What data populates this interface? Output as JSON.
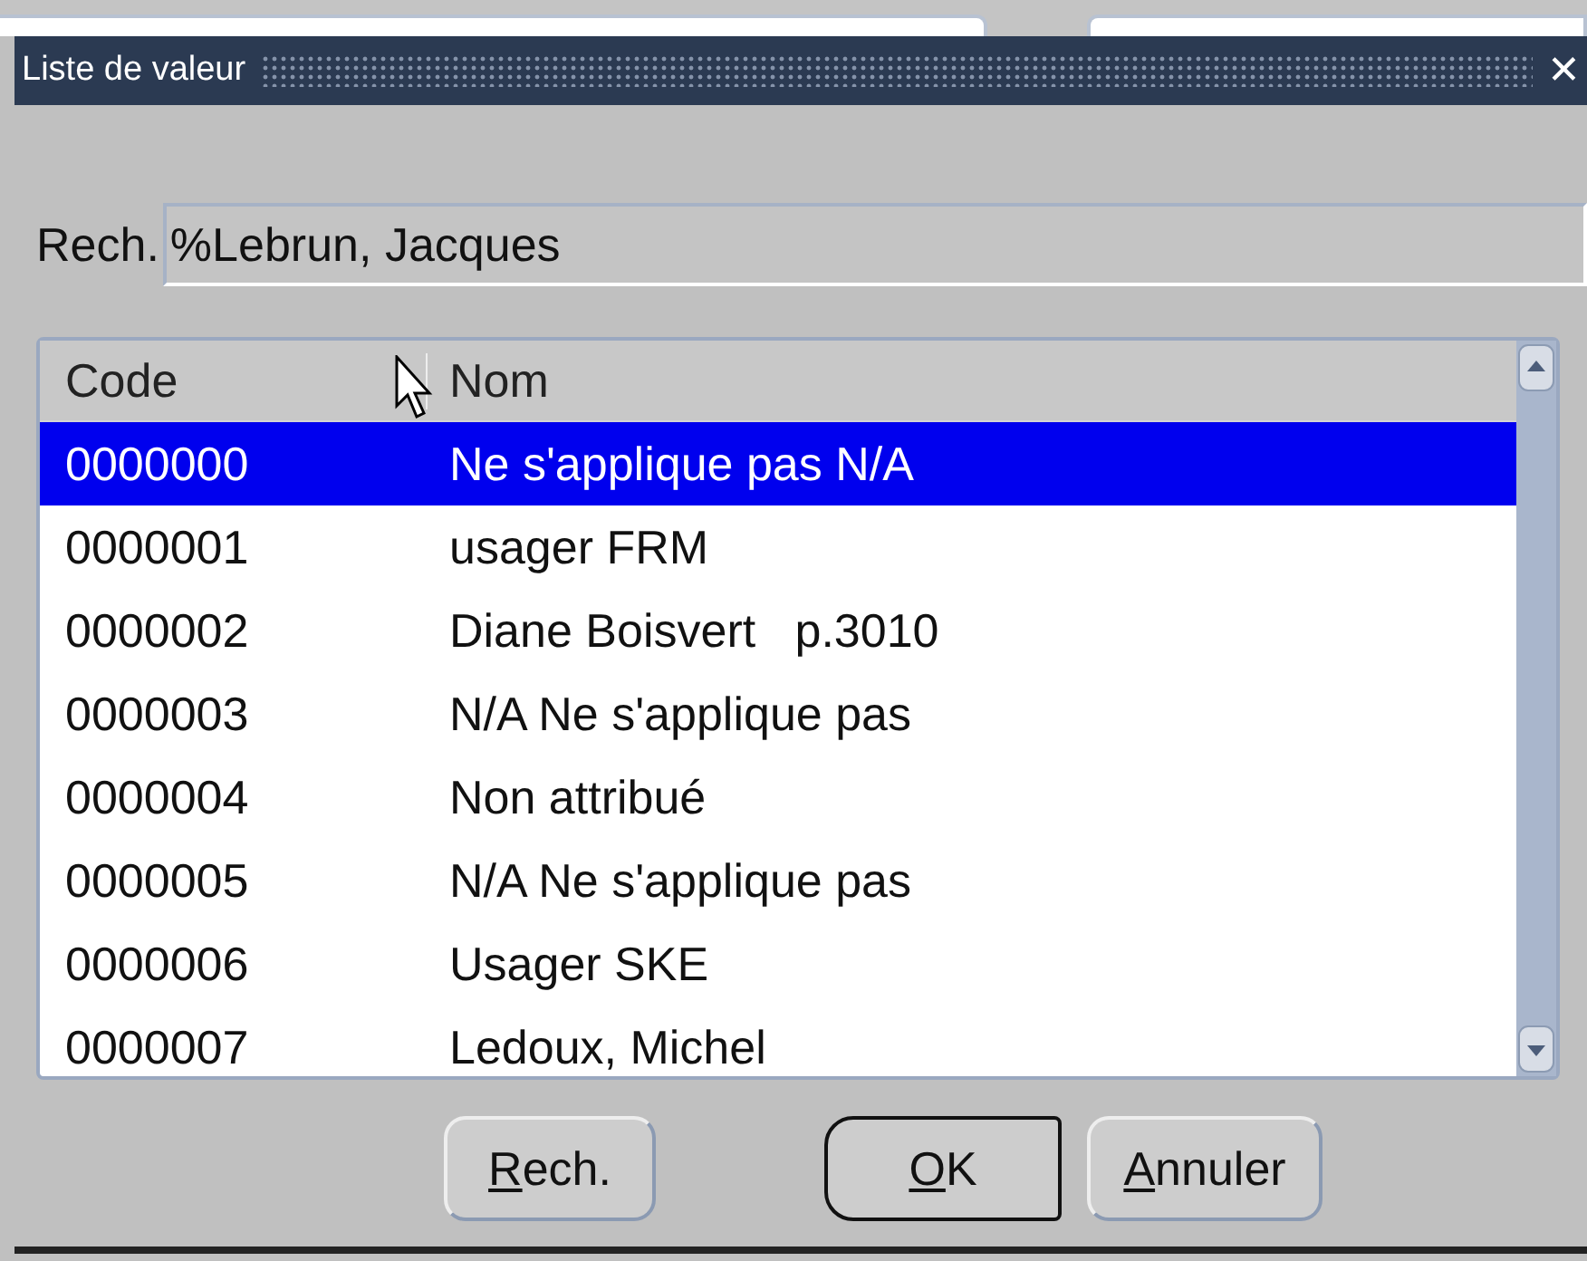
{
  "window": {
    "title": "Liste de valeur",
    "close": "✕"
  },
  "search": {
    "label": "Rech.",
    "value": "%Lebrun, Jacques"
  },
  "table": {
    "columns": [
      "Code",
      "Nom"
    ],
    "rows": [
      {
        "code": "0000000",
        "name": "Ne s'applique pas N/A",
        "selected": true
      },
      {
        "code": "0000001",
        "name": "usager FRM",
        "selected": false
      },
      {
        "code": "0000002",
        "name": "Diane Boisvert   p.3010",
        "selected": false
      },
      {
        "code": "0000003",
        "name": "N/A Ne s'applique pas",
        "selected": false
      },
      {
        "code": "0000004",
        "name": "Non attribué",
        "selected": false
      },
      {
        "code": "0000005",
        "name": "N/A Ne s'applique pas",
        "selected": false
      },
      {
        "code": "0000006",
        "name": "Usager SKE",
        "selected": false
      },
      {
        "code": "0000007",
        "name": "Ledoux, Michel",
        "selected": false
      }
    ]
  },
  "buttons": [
    {
      "label": "Rech.",
      "default": false
    },
    {
      "label": "OK",
      "default": true
    },
    {
      "label": "Annuler",
      "default": false
    }
  ]
}
